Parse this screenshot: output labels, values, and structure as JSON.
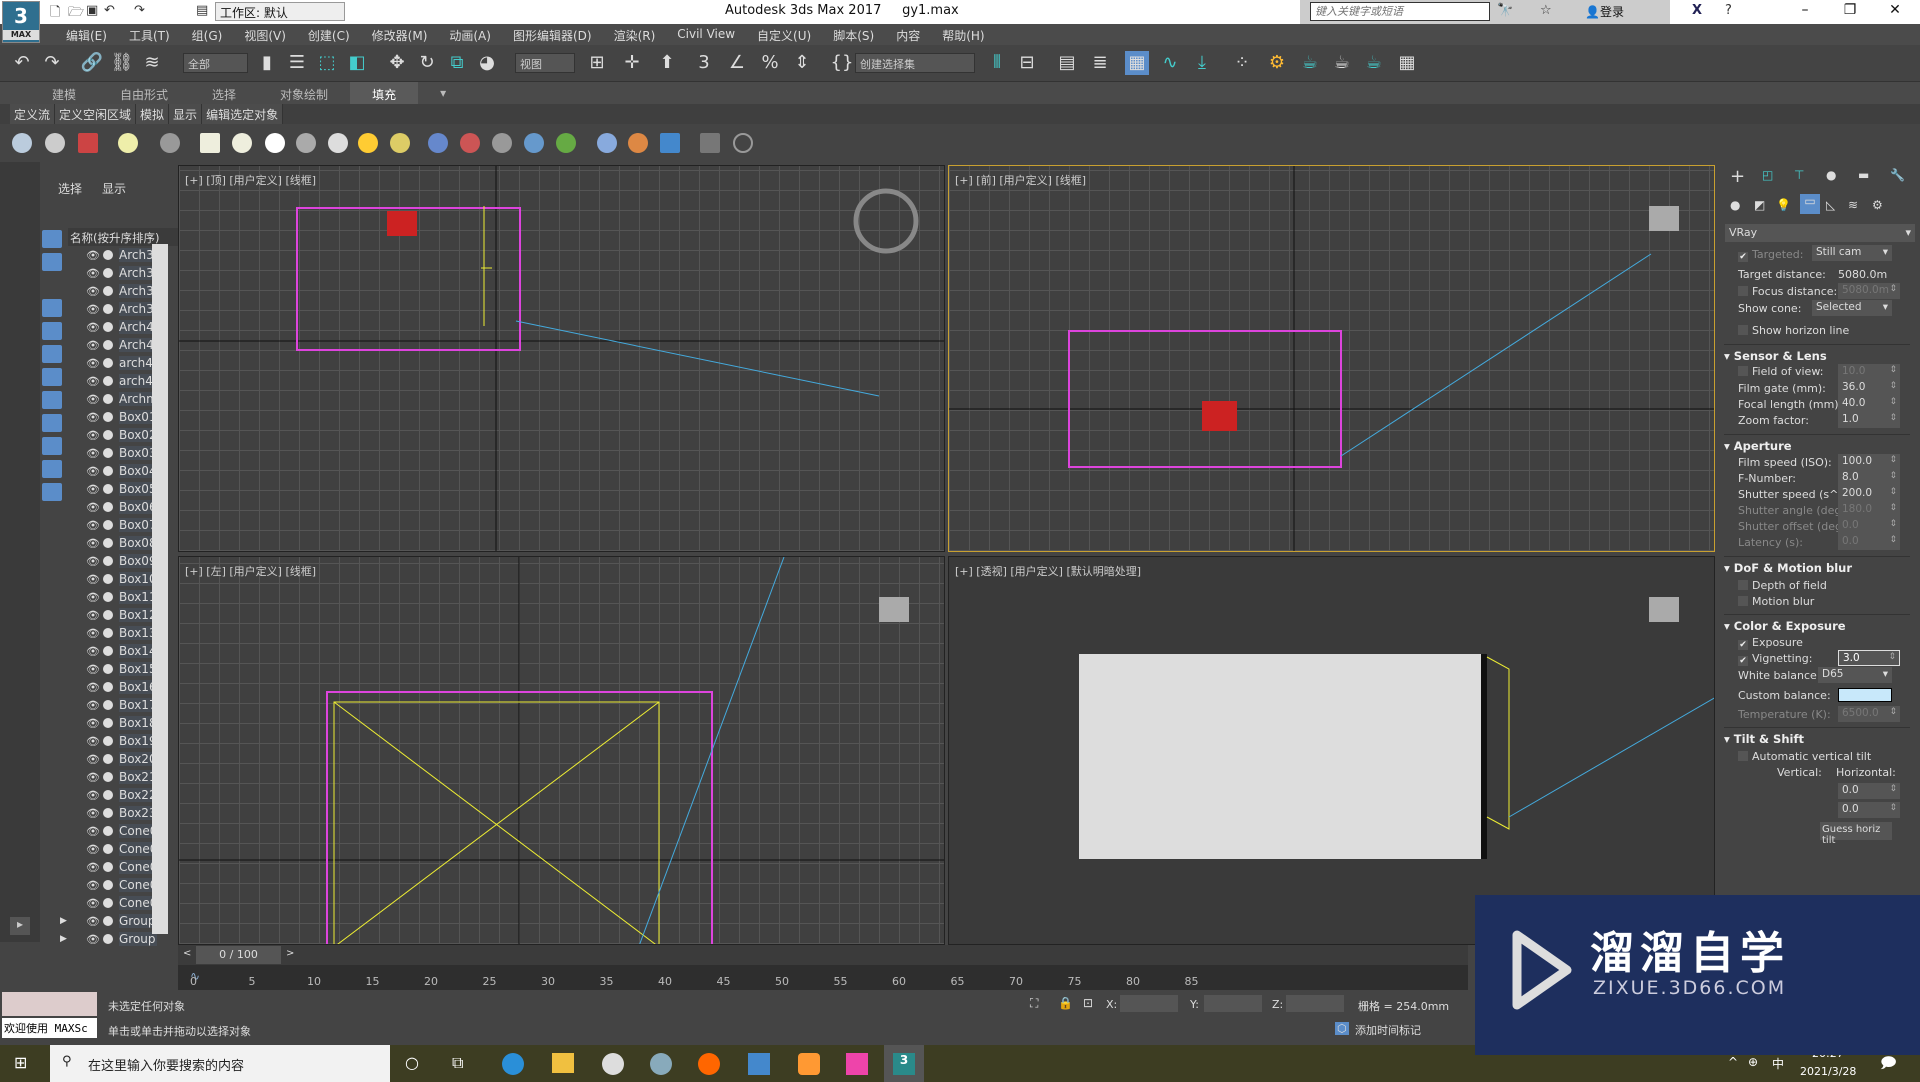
{
  "titlebar": {
    "workspace": "工作区: 默认",
    "app_title": "Autodesk 3ds Max 2017",
    "file": "gy1.max",
    "search_placeholder": "键入关键字或短语",
    "login": "登录",
    "logo_top": "3",
    "logo_bottom": "MAX"
  },
  "menu": [
    "编辑(E)",
    "工具(T)",
    "组(G)",
    "视图(V)",
    "创建(C)",
    "修改器(M)",
    "动画(A)",
    "图形编辑器(D)",
    "渲染(R)",
    "Civil View",
    "自定义(U)",
    "脚本(S)",
    "内容",
    "帮助(H)"
  ],
  "toolbar": {
    "filter": "全部",
    "ref_coord": "视图",
    "selection_set": "创建选择集"
  },
  "ribbon": {
    "tabs": [
      "建模",
      "自由形式",
      "选择",
      "对象绘制",
      "填充"
    ],
    "active": "填充",
    "subtabs": [
      "定义流",
      "定义空闲区域",
      "模拟",
      "显示",
      "编辑选定对象"
    ]
  },
  "explorer": {
    "tabs": [
      "选择",
      "显示"
    ],
    "column": "名称(按升序排序)",
    "items": [
      "Arch3",
      "Arch3",
      "Arch3",
      "Arch3",
      "Arch4",
      "Arch4",
      "arch4",
      "arch4",
      "Archm",
      "Box01",
      "Box02",
      "Box03",
      "Box04",
      "Box05",
      "Box06",
      "Box07",
      "Box08",
      "Box09",
      "Box10",
      "Box11",
      "Box12",
      "Box13",
      "Box14",
      "Box15",
      "Box16",
      "Box17",
      "Box18",
      "Box19",
      "Box20",
      "Box21",
      "Box22",
      "Box23",
      "Cone0",
      "Cone0",
      "Cone0",
      "Cone0",
      "Cone0",
      "Group",
      "Group"
    ]
  },
  "viewports": {
    "top": "[+] [顶] [用户定义] [线框]",
    "front": "[+] [前] [用户定义] [线框]",
    "left": "[+] [左] [用户定义] [线框]",
    "perspective": "[+] [透视] [用户定义] [默认明暗处理]"
  },
  "panel": {
    "renderer": "VRay",
    "targeted": "Targeted:",
    "camera_type": "Still cam",
    "target_distance_label": "Target distance:",
    "target_distance": "5080.0m",
    "focus_label": "Focus distance:",
    "focus_value": "5080.0m",
    "show_cone_label": "Show cone:",
    "show_cone": "Selected",
    "horizon": "Show horizon line",
    "sensor_head": "Sensor & Lens",
    "fov_label": "Field of view:",
    "fov": "10.0",
    "film_gate_label": "Film gate (mm):",
    "film_gate": "36.0",
    "focal_label": "Focal length (mm):",
    "focal": "40.0",
    "zoom_label": "Zoom factor:",
    "zoom": "1.0",
    "aperture_head": "Aperture",
    "iso_label": "Film speed (ISO):",
    "iso": "100.0",
    "fnum_label": "F-Number:",
    "fnum": "8.0",
    "shutter_label": "Shutter speed (s^-1",
    "shutter": "200.0",
    "angle_label": "Shutter angle (deg):",
    "angle": "180.0",
    "offset_label": "Shutter offset (deg):",
    "offset": "0.0",
    "latency_label": "Latency (s):",
    "latency": "0.0",
    "dof_head": "DoF & Motion blur",
    "dof": "Depth of field",
    "motion": "Motion blur",
    "color_head": "Color & Exposure",
    "exposure": "Exposure",
    "vignetting_label": "Vignetting:",
    "vignetting": "3.0",
    "wb_label": "White balance:",
    "wb": "D65",
    "custom_label": "Custom balance:",
    "custom_color": "#c8e8fa",
    "temp_label": "Temperature (K):",
    "temp": "6500.0",
    "tilt_head": "Tilt & Shift",
    "auto_tilt": "Automatic vertical tilt",
    "vertical": "Vertical:",
    "horizontal": "Horizontal:",
    "h1": "0.0",
    "h2": "0.0",
    "guess": "Guess horiz tilt"
  },
  "timeline": {
    "frame": "0 / 100",
    "ticks": [
      "0",
      "5",
      "10",
      "15",
      "20",
      "25",
      "30",
      "35",
      "40",
      "45",
      "50",
      "55",
      "60",
      "65",
      "70",
      "75",
      "80",
      "85"
    ]
  },
  "status": {
    "selection": "未选定任何对象",
    "hint": "单击或单击并拖动以选择对象",
    "maxscript": "欢迎使用 MAXSc",
    "x": "X:",
    "y": "Y:",
    "z": "Z:",
    "grid": "栅格 = 254.0mm",
    "add_tag": "添加时间标记"
  },
  "taskbar": {
    "search": "在这里输入你要搜索的内容",
    "time": "20:27",
    "date": "2021/3/28",
    "ime": "中"
  },
  "watermark": {
    "brand": "溜溜自学",
    "url": "ZIXUE.3D66.COM"
  }
}
